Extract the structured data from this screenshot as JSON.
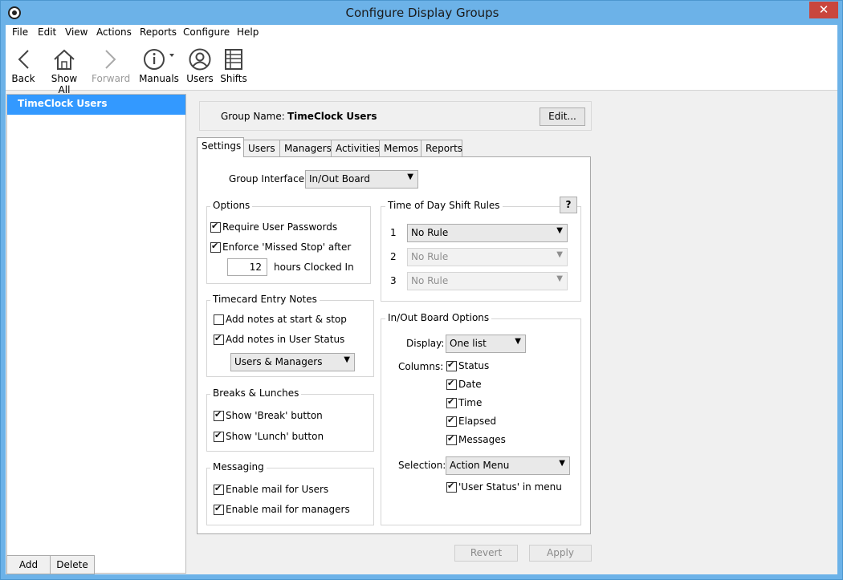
{
  "window": {
    "title": "Configure Display Groups",
    "close": "✕"
  },
  "menu": [
    "File",
    "Edit",
    "View",
    "Actions",
    "Reports",
    "Configure",
    "Help"
  ],
  "toolbar": {
    "back": "Back",
    "show_all": "Show All",
    "forward": "Forward",
    "manuals": "Manuals",
    "users": "Users",
    "shifts": "Shifts"
  },
  "groups": {
    "selected": "TimeClock Users",
    "add": "Add",
    "delete": "Delete"
  },
  "group_name": {
    "label": "Group Name:",
    "value": "TimeClock Users",
    "edit": "Edit..."
  },
  "tabs": [
    "Settings",
    "Users",
    "Managers",
    "Activities",
    "Memos",
    "Reports"
  ],
  "settings": {
    "interface_label": "Group Interface:",
    "interface_value": "In/Out Board",
    "options": {
      "title": "Options",
      "require_passwords": "Require User Passwords",
      "enforce_missed_stop": "Enforce 'Missed Stop' after",
      "hours_value": "12",
      "hours_label": "hours Clocked In"
    },
    "timecard": {
      "title": "Timecard Entry Notes",
      "start_stop": "Add notes at start & stop",
      "user_status": "Add notes in User Status",
      "who": "Users & Managers"
    },
    "breaks": {
      "title": "Breaks & Lunches",
      "break": "Show 'Break' button",
      "lunch": "Show 'Lunch' button"
    },
    "messaging": {
      "title": "Messaging",
      "users": "Enable mail for Users",
      "managers": "Enable mail for managers"
    },
    "shift_rules": {
      "title": "Time of Day Shift Rules",
      "help": "?",
      "rows": [
        {
          "num": "1",
          "value": "No Rule"
        },
        {
          "num": "2",
          "value": "No Rule"
        },
        {
          "num": "3",
          "value": "No Rule"
        }
      ]
    },
    "board": {
      "title": "In/Out Board Options",
      "display_label": "Display:",
      "display_value": "One list",
      "columns_label": "Columns:",
      "columns": [
        "Status",
        "Date",
        "Time",
        "Elapsed",
        "Messages"
      ],
      "selection_label": "Selection:",
      "selection_value": "Action Menu",
      "user_status_menu": "'User Status' in menu"
    }
  },
  "footer": {
    "revert": "Revert",
    "apply": "Apply"
  },
  "colors": {
    "accent": "#3399ff",
    "title_bar": "#6cb2e8",
    "close": "#c9463d"
  }
}
